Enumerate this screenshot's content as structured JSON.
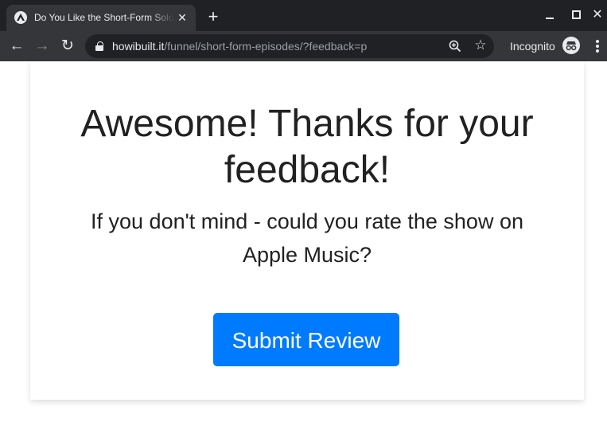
{
  "browser": {
    "tab_title": "Do You Like the Short-Form Solo",
    "tab_close": "✕",
    "new_tab": "+",
    "url_host": "howibuilt.it",
    "url_path": "/funnel/short-form-episodes/?feedback=p",
    "incognito_label": "Incognito",
    "back": "←",
    "forward": "→",
    "reload": "↻",
    "star": "☆",
    "close_window": "✕"
  },
  "page": {
    "headline": "Awesome! Thanks for your feedback!",
    "subtext": "If you don't mind - could you rate the show on Apple Music?",
    "button_label": "Submit Review"
  },
  "colors": {
    "button": "#007bff",
    "text": "#212121",
    "chrome_dark": "#202124",
    "chrome_toolbar": "#35363a"
  }
}
